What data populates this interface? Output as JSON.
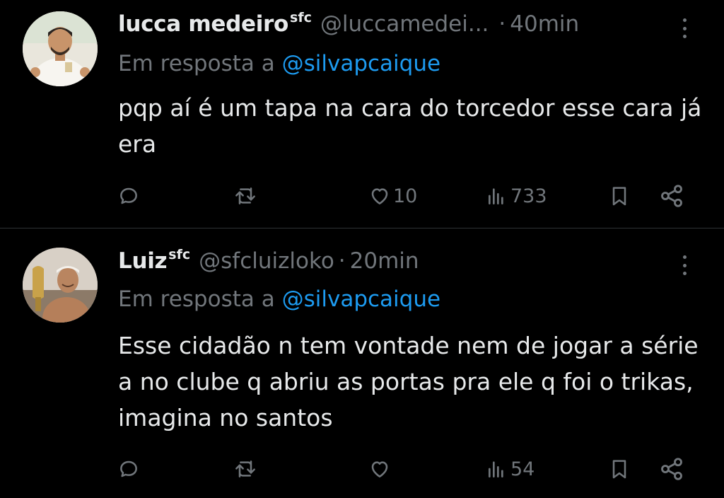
{
  "tweets": [
    {
      "author": {
        "name": "lucca medeiro",
        "badge": "sfc",
        "handle": "@luccamedei...",
        "avatar": "man-in-white-shirt-photo"
      },
      "separator": "·",
      "time": "40min",
      "reply_prefix": "Em resposta a",
      "reply_to": "@silvapcaique",
      "text": "pqp aí é um tapa na cara do torcedor esse cara já era",
      "actions": {
        "replies": "",
        "retweets": "",
        "likes": "10",
        "views": "733"
      }
    },
    {
      "author": {
        "name": "Luiz",
        "badge": "sfc",
        "handle": "@sfcluizloko",
        "avatar": "man-with-trophy-photo"
      },
      "separator": "·",
      "time": "20min",
      "reply_prefix": "Em resposta a",
      "reply_to": "@silvapcaique",
      "text": "Esse cidadão n tem vontade nem de jogar a série a no clube q abriu as portas pra ele q foi o trikas, imagina no santos",
      "actions": {
        "replies": "",
        "retweets": "",
        "likes": "",
        "views": "54"
      }
    }
  ],
  "icons": {
    "reply": "reply-icon",
    "retweet": "retweet-icon",
    "like": "heart-icon",
    "views": "views-icon",
    "bookmark": "bookmark-icon",
    "share": "share-icon",
    "more": "more-icon"
  },
  "colors": {
    "background": "#000000",
    "text": "#e7e9ea",
    "muted": "#71767b",
    "link": "#1d9bf0",
    "divider": "#2f3336"
  }
}
